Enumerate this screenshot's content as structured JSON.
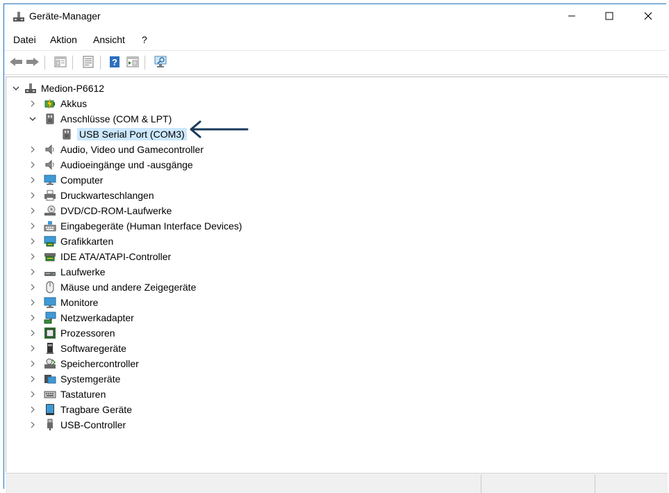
{
  "window": {
    "title": "Geräte-Manager",
    "minimize_icon": "minimize-icon",
    "maximize_icon": "maximize-icon",
    "close_icon": "close-icon"
  },
  "menu": {
    "items": [
      "Datei",
      "Aktion",
      "Ansicht",
      "?"
    ]
  },
  "toolbar": {
    "buttons": [
      "back-arrow-icon",
      "forward-arrow-icon",
      "properties-pane-icon",
      "device-properties-icon",
      "help-icon",
      "action-pane-icon",
      "monitor-scan-icon"
    ]
  },
  "tree": {
    "root": "Medion-P6612",
    "items": [
      {
        "label": "Akkus",
        "icon": "battery-icon"
      },
      {
        "label": "Anschlüsse (COM & LPT)",
        "icon": "port-icon",
        "expanded": true,
        "children": [
          {
            "label": "USB Serial Port (COM3)",
            "icon": "serial-port-icon",
            "selected": true
          }
        ]
      },
      {
        "label": "Audio, Video und Gamecontroller",
        "icon": "speaker-icon"
      },
      {
        "label": "Audioeingänge und -ausgänge",
        "icon": "speaker-icon"
      },
      {
        "label": "Computer",
        "icon": "computer-icon"
      },
      {
        "label": "Druckwarteschlangen",
        "icon": "printer-icon"
      },
      {
        "label": "DVD/CD-ROM-Laufwerke",
        "icon": "disc-drive-icon"
      },
      {
        "label": "Eingabegeräte (Human Interface Devices)",
        "icon": "keyboard-device-icon"
      },
      {
        "label": "Grafikkarten",
        "icon": "display-adapter-icon"
      },
      {
        "label": "IDE ATA/ATAPI-Controller",
        "icon": "ide-controller-icon"
      },
      {
        "label": "Laufwerke",
        "icon": "disk-drive-icon"
      },
      {
        "label": "Mäuse und andere Zeigegeräte",
        "icon": "mouse-icon"
      },
      {
        "label": "Monitore",
        "icon": "monitor-icon"
      },
      {
        "label": "Netzwerkadapter",
        "icon": "network-icon"
      },
      {
        "label": "Prozessoren",
        "icon": "processor-icon"
      },
      {
        "label": "Softwaregeräte",
        "icon": "software-device-icon"
      },
      {
        "label": "Speichercontroller",
        "icon": "storage-controller-icon"
      },
      {
        "label": "Systemgeräte",
        "icon": "system-device-icon"
      },
      {
        "label": "Tastaturen",
        "icon": "keyboard-icon"
      },
      {
        "label": "Tragbare Geräte",
        "icon": "portable-device-icon"
      },
      {
        "label": "USB-Controller",
        "icon": "usb-icon"
      }
    ]
  },
  "colors": {
    "selection": "#cce8ff",
    "annotation_arrow": "#1a3a5c",
    "window_border": "#1f6fb2"
  }
}
